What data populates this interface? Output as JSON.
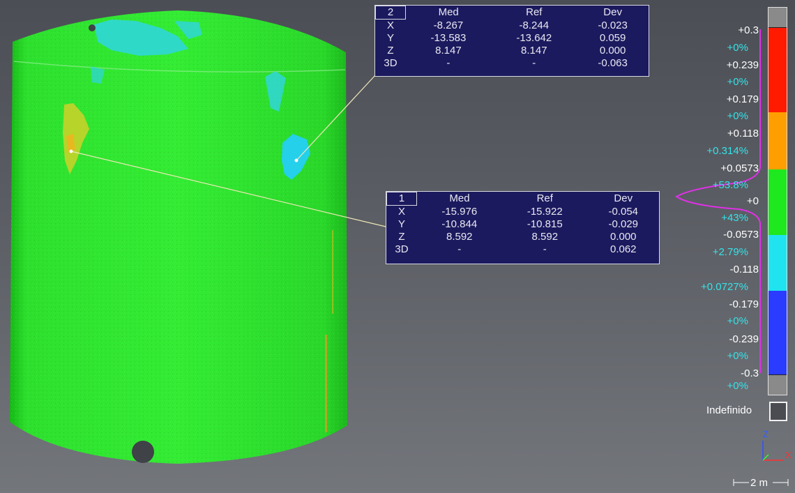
{
  "callout_2": {
    "id": "2",
    "headers": [
      "Med",
      "Ref",
      "Dev"
    ],
    "rows": [
      {
        "axis": "X",
        "med": "-8.267",
        "ref": "-8.244",
        "dev": "-0.023"
      },
      {
        "axis": "Y",
        "med": "-13.583",
        "ref": "-13.642",
        "dev": "0.059"
      },
      {
        "axis": "Z",
        "med": "8.147",
        "ref": "8.147",
        "dev": "0.000"
      },
      {
        "axis": "3D",
        "med": "-",
        "ref": "-",
        "dev": "-0.063"
      }
    ]
  },
  "callout_1": {
    "id": "1",
    "headers": [
      "Med",
      "Ref",
      "Dev"
    ],
    "rows": [
      {
        "axis": "X",
        "med": "-15.976",
        "ref": "-15.922",
        "dev": "-0.054"
      },
      {
        "axis": "Y",
        "med": "-10.844",
        "ref": "-10.815",
        "dev": "-0.029"
      },
      {
        "axis": "Z",
        "med": "8.592",
        "ref": "8.592",
        "dev": "0.000"
      },
      {
        "axis": "3D",
        "med": "-",
        "ref": "-",
        "dev": "0.062"
      }
    ]
  },
  "scale": {
    "values": [
      "+0.3",
      "+0.239",
      "+0.179",
      "+0.118",
      "+0.0573",
      "+0",
      "-0.0573",
      "-0.118",
      "-0.179",
      "-0.239",
      "-0.3"
    ],
    "percentages": [
      "+0%",
      "+0%",
      "+0%",
      "+0.314%",
      "+53.8%",
      "+43%",
      "+2.79%",
      "+0.0727%",
      "+0%",
      "+0%",
      "+0%"
    ],
    "colors": {
      "top_gray": "#8a8a8a",
      "red": "#ff1a00",
      "orange": "#ff9e00",
      "green": "#1ee81e",
      "cyan": "#1fe4f0",
      "blue": "#2a3cff",
      "bottom_gray": "#8a8a8a"
    },
    "histogram_color": "#e030e8"
  },
  "undefined_label": "Indefinido",
  "axes": {
    "z": "Z",
    "x": "X"
  },
  "scalebar_label": "2 m"
}
